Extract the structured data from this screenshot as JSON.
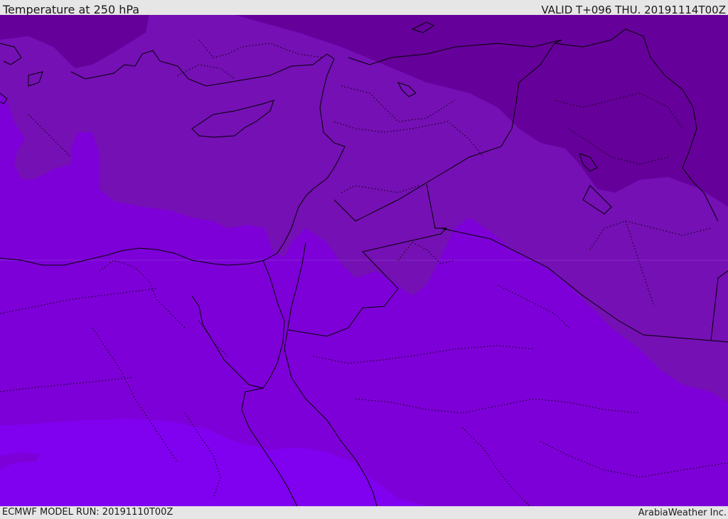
{
  "header": {
    "title": "Temperature at 250 hPa",
    "valid": "VALID T+096 THU. 20191114T00Z"
  },
  "footer": {
    "model_run": "ECMWF MODEL RUN: 20191110T00Z",
    "credit": "ArabiaWeather Inc."
  },
  "colors": {
    "coldest": "#66009a",
    "cold": "#7510b4",
    "mid": "#7e00d8",
    "warm": "#8000f0",
    "border": "#000000",
    "bar": "#e6e6e6"
  }
}
